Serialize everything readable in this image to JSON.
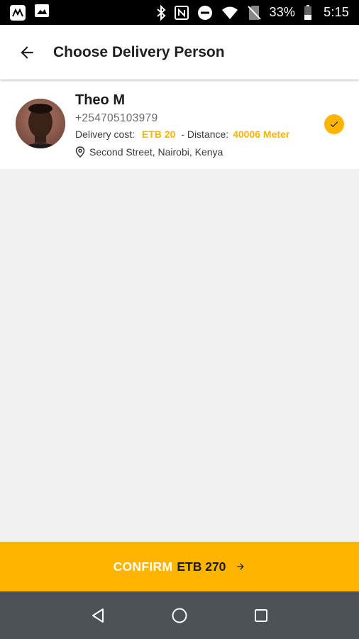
{
  "status_bar": {
    "battery_text": "33%",
    "time": "5:15",
    "icons": [
      "app-logo-icon",
      "image-icon",
      "bluetooth-icon",
      "nfc-icon",
      "do-not-disturb-icon",
      "wifi-icon",
      "no-sim-icon",
      "battery-icon"
    ]
  },
  "app_bar": {
    "title": "Choose Delivery Person",
    "back_icon": "arrow-left-icon"
  },
  "delivery_person": {
    "name": "Theo M",
    "phone": "+254705103979",
    "cost_label": "Delivery cost:",
    "cost_value": "ETB 20",
    "distance_label": "- Distance:",
    "distance_value": "40006 Meter",
    "location": "Second Street, Nairobi, Kenya",
    "selected": true
  },
  "confirm": {
    "label": "CONFIRM",
    "amount": "ETB 270",
    "arrow_icon": "arrow-right-icon"
  },
  "nav_bar": {
    "icons": [
      "back-triangle-icon",
      "home-circle-icon",
      "recents-square-icon"
    ]
  },
  "colors": {
    "accent": "#ffb400",
    "accent_text": "#f7b500",
    "status_bar": "#000000",
    "nav_bar": "#4d5257",
    "background": "#f0f0f0"
  }
}
